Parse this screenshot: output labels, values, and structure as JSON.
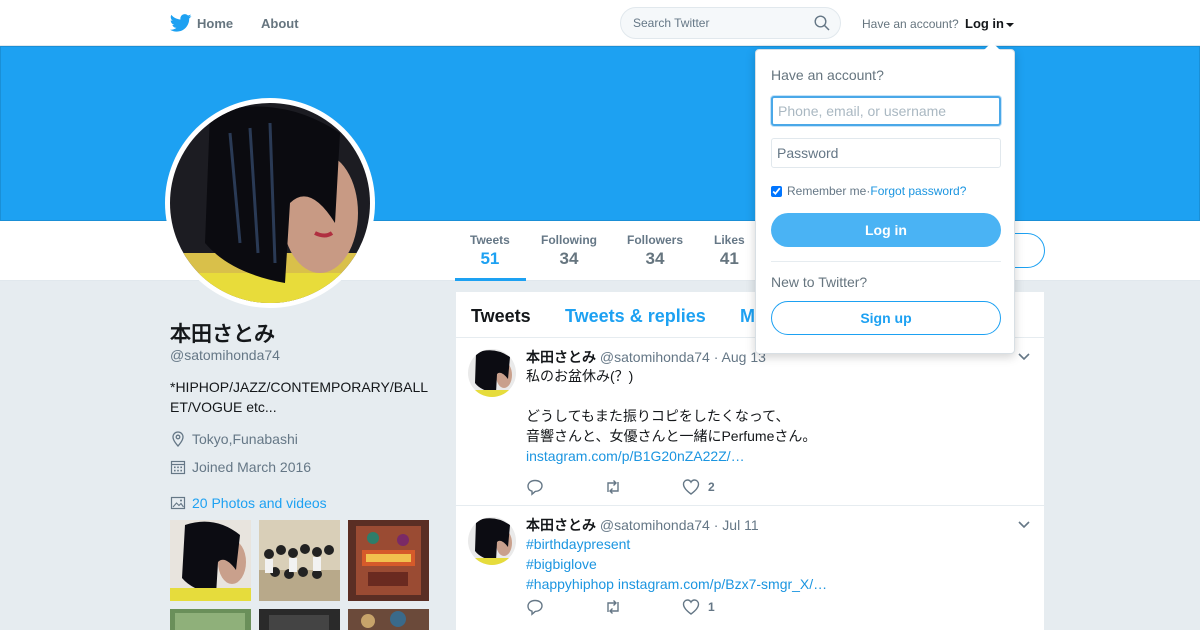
{
  "header": {
    "home_label": "Home",
    "about_label": "About",
    "search_placeholder": "Search Twitter",
    "have_account": "Have an account?",
    "login_label": "Log in"
  },
  "profile": {
    "name": "本田さとみ",
    "handle": "@satomihonda74",
    "bio": "*HIPHOP/JAZZ/CONTEMPORARY/BALLET/VOGUE etc...",
    "location": "Tokyo,Funabashi",
    "joined": "Joined March 2016",
    "photos_link": "20 Photos and videos"
  },
  "stats": [
    {
      "label": "Tweets",
      "value": "51"
    },
    {
      "label": "Following",
      "value": "34"
    },
    {
      "label": "Followers",
      "value": "34"
    },
    {
      "label": "Likes",
      "value": "41"
    }
  ],
  "timeline": {
    "tabs": [
      "Tweets",
      "Tweets & replies",
      "M"
    ],
    "tweets": [
      {
        "name": "本田さとみ",
        "handle": "@satomihonda74",
        "date": "· Aug 13",
        "lines": [
          "私のお盆休み(？)",
          "",
          "どうしてもまた振りコピをしたくなって、",
          "音響さんと、女優さんと一緒にPerfumeさん。"
        ],
        "link": "instagram.com/p/B1G20nZA22Z/…",
        "likes": "2"
      },
      {
        "name": "本田さとみ",
        "handle": "@satomihonda74",
        "date": "· Jul 11",
        "tags": [
          "#birthdaypresent",
          "#bigbiglove",
          "#happyhiphop"
        ],
        "link": "instagram.com/p/Bzx7-smgr_X/…",
        "likes": "1"
      }
    ]
  },
  "login_dropdown": {
    "title": "Have an account?",
    "username_placeholder": "Phone, email, or username",
    "password_placeholder": "Password",
    "remember_me": "Remember me",
    "separator": " · ",
    "forgot_password": "Forgot password?",
    "login_button": "Log in",
    "new_to_twitter": "New to Twitter?",
    "signup_button": "Sign up"
  },
  "colors": {
    "accent": "#1da1f2",
    "banner": "#1da1f2",
    "login_button": "#4ab3f4",
    "page_bg": "#e6ecf0"
  },
  "icons": [
    "twitter-bird-icon",
    "search-icon",
    "location-icon",
    "calendar-icon",
    "photos-icon",
    "reply-icon",
    "retweet-icon",
    "like-icon",
    "chevron-down-icon"
  ]
}
